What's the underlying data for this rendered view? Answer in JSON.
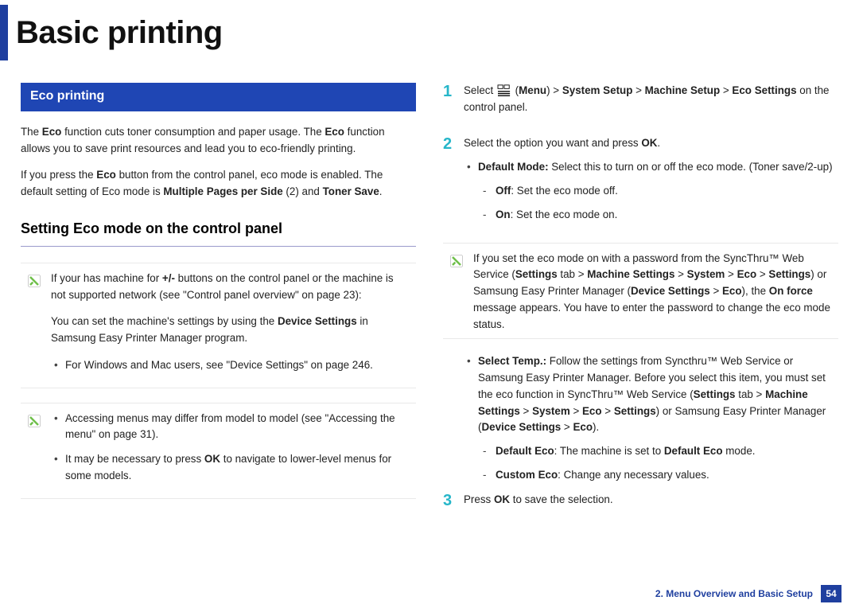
{
  "title": "Basic printing",
  "section_heading": "Eco printing",
  "left": {
    "intro1_a": "The ",
    "intro1_b": "Eco",
    "intro1_c": " function cuts toner consumption and paper usage. The ",
    "intro1_d": "Eco",
    "intro1_e": " function allows you to save print resources and lead you to eco-friendly printing.",
    "intro2_a": "If you press the ",
    "intro2_b": "Eco",
    "intro2_c": " button from the control panel, eco mode is enabled. The default setting of Eco mode is ",
    "intro2_d": "Multiple Pages per Side",
    "intro2_e": " (2) and ",
    "intro2_f": "Toner Save",
    "intro2_g": ".",
    "subhead": "Setting Eco mode on the control panel",
    "note1_p1_a": "If your has machine for ",
    "note1_p1_b": "+/-",
    "note1_p1_c": " buttons on the control panel or the machine is not supported network (see \"Control panel overview\" on page 23):",
    "note1_p2_a": "You can set the machine's settings by using the ",
    "note1_p2_b": "Device Settings",
    "note1_p2_c": " in Samsung Easy Printer Manager program.",
    "note1_bullet": "For Windows and Mac users, see \"Device Settings\" on page 246.",
    "note2_b1": "Accessing menus may differ from model to model (see \"Accessing the menu\" on page 31).",
    "note2_b2_a": "It may be necessary to press ",
    "note2_b2_b": "OK",
    "note2_b2_c": " to navigate to lower-level menus for some models."
  },
  "right": {
    "step1_a": "Select ",
    "step1_b": " (",
    "step1_c": "Menu",
    "step1_d": ") > ",
    "step1_e": "System Setup",
    "step1_f": " > ",
    "step1_g": "Machine Setup",
    "step1_h": " > ",
    "step1_i": "Eco Settings",
    "step1_j": " on the control panel.",
    "step2_a": "Select the option you want and press ",
    "step2_b": "OK",
    "step2_c": ".",
    "step2_bullet1_a": "Default Mode:",
    "step2_bullet1_b": " Select this to turn on or off the eco mode. (Toner save/2-up)",
    "step2_dash1_a": "Off",
    "step2_dash1_b": ": Set the eco mode off.",
    "step2_dash2_a": "On",
    "step2_dash2_b": ": Set the eco mode on.",
    "note3_a": "If you set the eco mode on with a password from the SyncThru™ Web Service (",
    "note3_b": "Settings",
    "note3_c": " tab > ",
    "note3_d": "Machine Settings",
    "note3_e": " > ",
    "note3_f": "System",
    "note3_g": " > ",
    "note3_h": "Eco",
    "note3_i": " > ",
    "note3_j": "Settings",
    "note3_k": ") or Samsung Easy Printer Manager (",
    "note3_l": "Device Settings",
    "note3_m": " > ",
    "note3_n": "Eco",
    "note3_o": "), the ",
    "note3_p": "On force",
    "note3_q": " message appears. You have to enter the password to change the eco mode status.",
    "step2_bullet2_a": "Select Temp.:",
    "step2_bullet2_b": " Follow the settings from Syncthru™ Web Service or Samsung Easy Printer Manager. Before you select this item, you must set the eco function in SyncThru™ Web Service (",
    "step2_bullet2_c": "Settings",
    "step2_bullet2_d": " tab > ",
    "step2_bullet2_e": "Machine Settings",
    "step2_bullet2_f": " > ",
    "step2_bullet2_g": "System",
    "step2_bullet2_h": " > ",
    "step2_bullet2_i": "Eco",
    "step2_bullet2_j": " > ",
    "step2_bullet2_k": "Settings",
    "step2_bullet2_l": ") or Samsung Easy Printer Manager (",
    "step2_bullet2_m": "Device Settings",
    "step2_bullet2_n": " > ",
    "step2_bullet2_o": "Eco",
    "step2_bullet2_p": ").",
    "step2_dash3_a": "Default Eco",
    "step2_dash3_b": ": The machine is set to ",
    "step2_dash3_c": "Default Eco",
    "step2_dash3_d": " mode.",
    "step2_dash4_a": "Custom Eco",
    "step2_dash4_b": ": Change any necessary values.",
    "step3_a": "Press ",
    "step3_b": "OK",
    "step3_c": " to save the selection."
  },
  "footer": {
    "chapter": "2. Menu Overview and Basic Setup",
    "page": "54"
  },
  "nums": {
    "n1": "1",
    "n2": "2",
    "n3": "3"
  }
}
